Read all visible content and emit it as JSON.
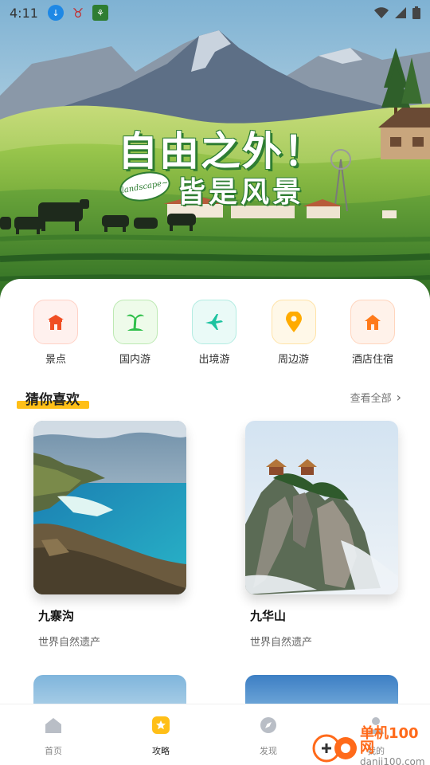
{
  "status_bar": {
    "time": "4:11"
  },
  "banner": {
    "title_line1": "自由之外！",
    "title_line2": "皆是风景",
    "tag": "landscape~"
  },
  "categories": [
    {
      "label": "景点",
      "icon": "temple-icon",
      "color": "#f04e23"
    },
    {
      "label": "国内游",
      "icon": "palm-tree-icon",
      "color": "#2fbf4a"
    },
    {
      "label": "出境游",
      "icon": "airplane-icon",
      "color": "#1cc3a0"
    },
    {
      "label": "周边游",
      "icon": "location-pin-icon",
      "color": "#ffab00"
    },
    {
      "label": "酒店住宿",
      "icon": "house-icon",
      "color": "#ff7a1a"
    }
  ],
  "recommend": {
    "title": "猜你喜欢",
    "more": "查看全部",
    "accent": "#ffbf17",
    "items": [
      {
        "name": "九寨沟",
        "desc": "世界自然遗产"
      },
      {
        "name": "九华山",
        "desc": "世界自然遗产"
      }
    ]
  },
  "bottom_nav": [
    {
      "label": "首页",
      "icon": "home-icon",
      "active": false
    },
    {
      "label": "攻略",
      "icon": "star-badge-icon",
      "active": true
    },
    {
      "label": "发现",
      "icon": "compass-icon",
      "active": false
    },
    {
      "label": "我的",
      "icon": "user-icon",
      "active": false
    }
  ],
  "watermark": {
    "text": "单机100网",
    "url": "danji100.com"
  }
}
